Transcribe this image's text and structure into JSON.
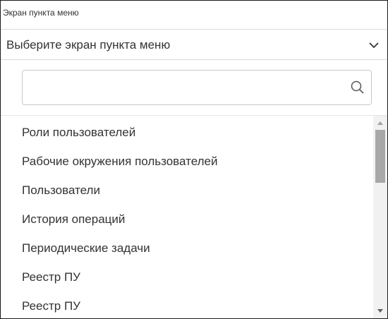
{
  "field": {
    "label": "Экран пункта меню",
    "placeholder": "Выберите экран пункта меню"
  },
  "dropdown": {
    "search_value": "",
    "items": [
      {
        "label": "Роли пользователей"
      },
      {
        "label": "Рабочие окружения пользователей"
      },
      {
        "label": "Пользователи"
      },
      {
        "label": "История операций"
      },
      {
        "label": "Периодические задачи"
      },
      {
        "label": "Реестр ПУ"
      },
      {
        "label": "Реестр ПУ"
      }
    ],
    "scroll_position": 0.0
  },
  "icons": {
    "select_toggle": "chevron-down-icon",
    "search": "search-icon",
    "scroll_up": "triangle-up-icon",
    "scroll_down": "triangle-down-icon"
  },
  "colors": {
    "text": "#333333",
    "border": "#c8c8c8",
    "scrollbar_track": "#f1f1f1",
    "scrollbar_thumb": "#a8a8a8"
  }
}
